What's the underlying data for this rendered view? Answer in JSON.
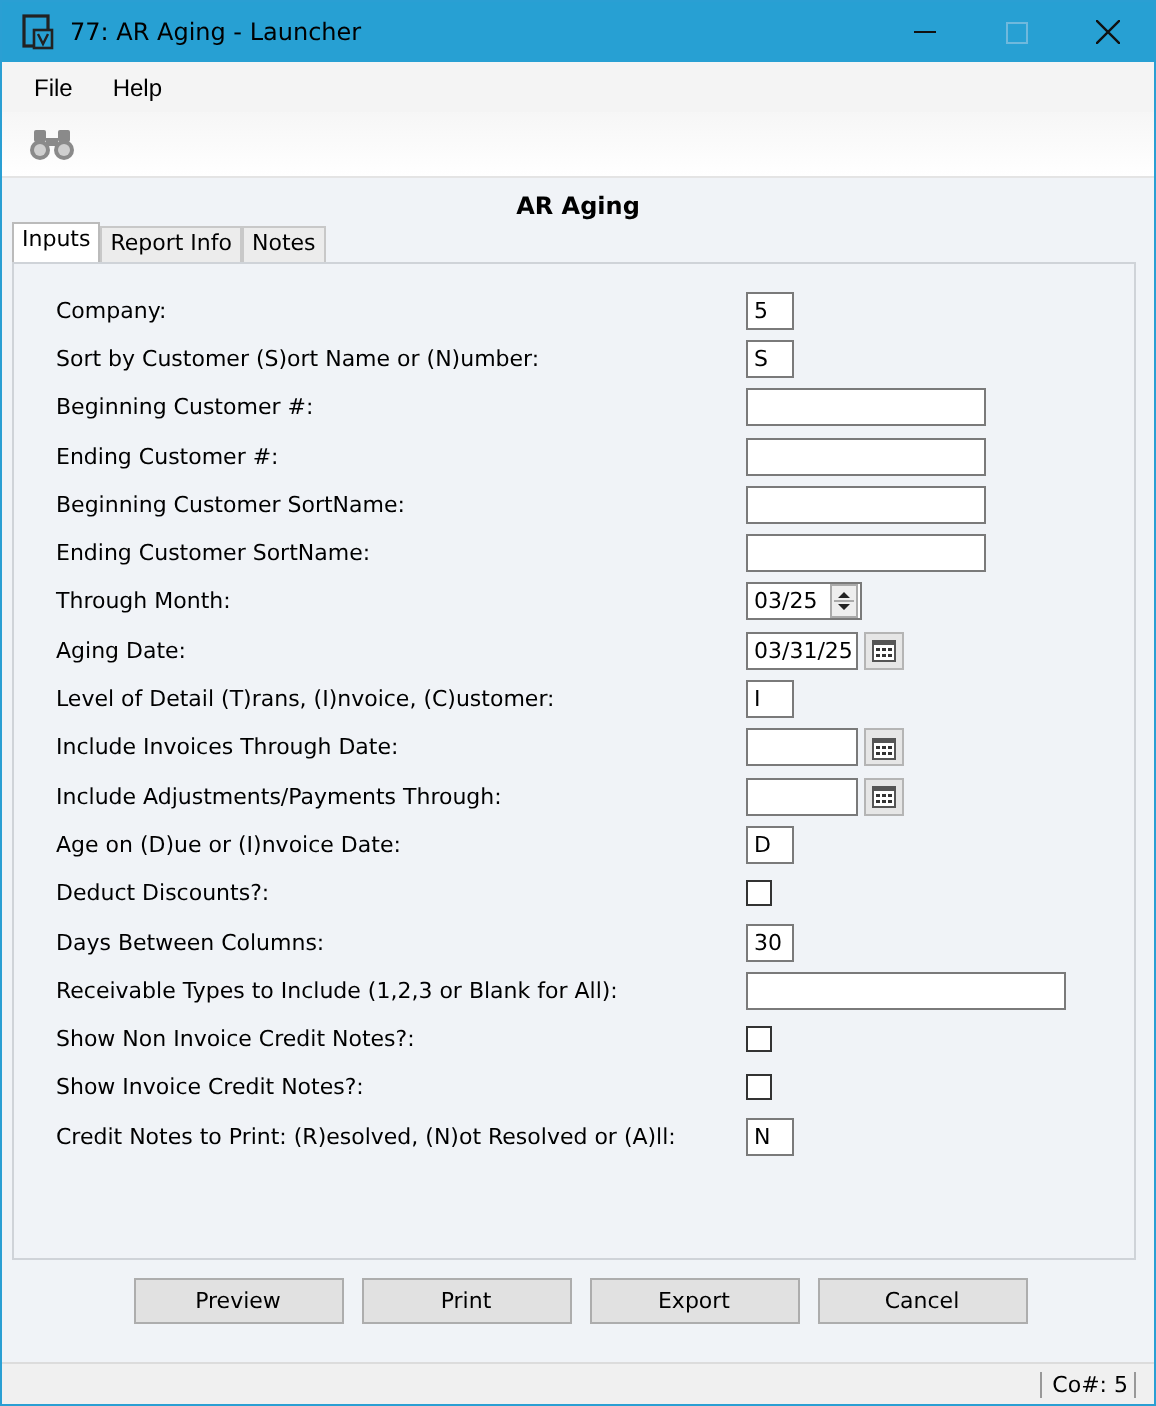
{
  "window": {
    "title": "77: AR Aging - Launcher"
  },
  "menu": [
    "File",
    "Help"
  ],
  "heading": "AR Aging",
  "tabs": [
    {
      "label": "Inputs",
      "selected": true
    },
    {
      "label": "Report Info",
      "selected": false
    },
    {
      "label": "Notes",
      "selected": false
    }
  ],
  "fields": [
    {
      "label": "Company:",
      "kind": "short",
      "value": "5"
    },
    {
      "label": "Sort by Customer (S)ort Name or (N)umber:",
      "kind": "short",
      "value": "S"
    },
    {
      "label": "Beginning Customer #:",
      "kind": "text"
    },
    {
      "label": "Ending Customer #:",
      "kind": "text"
    },
    {
      "label": "Beginning Customer SortName:",
      "kind": "text"
    },
    {
      "label": "Ending Customer SortName:",
      "kind": "text"
    },
    {
      "label": "Through Month:",
      "kind": "spin",
      "value": "03/25"
    },
    {
      "label": "Aging Date:",
      "kind": "date",
      "value": "03/31/25"
    },
    {
      "label": "Level of Detail (T)rans, (I)nvoice, (C)ustomer:",
      "kind": "short",
      "value": "I"
    },
    {
      "label": "Include Invoices Through Date:",
      "kind": "date"
    },
    {
      "label": "Include Adjustments/Payments Through:",
      "kind": "date"
    },
    {
      "label": "Age on (D)ue or (I)nvoice Date:",
      "kind": "short",
      "value": "D"
    },
    {
      "label": "Deduct Discounts?:",
      "kind": "check",
      "checked": false
    },
    {
      "label": "Days Between Columns:",
      "kind": "short",
      "value": "30"
    },
    {
      "label": "Receivable Types to Include (1,2,3 or Blank for All):",
      "kind": "long"
    },
    {
      "label": "Show Non Invoice Credit Notes?:",
      "kind": "check",
      "checked": false
    },
    {
      "label": "Show Invoice Credit Notes?:",
      "kind": "check",
      "checked": false
    },
    {
      "label": "Credit Notes to Print: (R)esolved, (N)ot Resolved or (A)ll:",
      "kind": "short",
      "value": "N"
    }
  ],
  "buttons": [
    "Preview",
    "Print",
    "Export",
    "Cancel"
  ],
  "status_bar": {
    "company": "Co#: 5"
  }
}
